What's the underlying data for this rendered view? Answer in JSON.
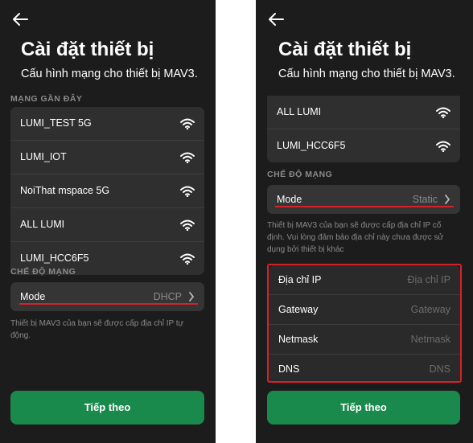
{
  "left_screen": {
    "title": "Cài đặt thiết bị",
    "subtitle": "Cấu hình mạng cho thiết bị MAV3.",
    "recent_networks_header": "MẠNG GẦN ĐÂY",
    "networks": [
      {
        "ssid": "LUMI_TEST 5G"
      },
      {
        "ssid": "LUMI_IOT"
      },
      {
        "ssid": "NoiThat mspace 5G"
      },
      {
        "ssid": "ALL LUMI"
      },
      {
        "ssid": "LUMI_HCC6F5"
      }
    ],
    "network_mode_header": "CHẾ ĐỘ MẠNG",
    "mode_label": "Mode",
    "mode_value": "DHCP",
    "description": "Thiết bị MAV3 của bạn sẽ được cấp địa chỉ IP tự động.",
    "next_button": "Tiếp theo"
  },
  "right_screen": {
    "title": "Cài đặt thiết bị",
    "subtitle": "Cấu hình mạng cho thiết bị MAV3.",
    "networks": [
      {
        "ssid": "ALL LUMI"
      },
      {
        "ssid": "LUMI_HCC6F5"
      }
    ],
    "network_mode_header": "CHẾ ĐỘ MẠNG",
    "mode_label": "Mode",
    "mode_value": "Static",
    "description": "Thiết bị MAV3 của bạn sẽ được cấp địa chỉ IP cố định. Vui lòng đảm bảo địa chỉ này chưa được sử dụng bởi thiết bị khác",
    "static_fields": [
      {
        "label": "Địa chỉ IP",
        "placeholder": "Địa chỉ IP"
      },
      {
        "label": "Gateway",
        "placeholder": "Gateway"
      },
      {
        "label": "Netmask",
        "placeholder": "Netmask"
      },
      {
        "label": "DNS",
        "placeholder": "DNS"
      }
    ],
    "next_button": "Tiếp theo"
  },
  "colors": {
    "background": "#1c1c1c",
    "card": "#2f2f2f",
    "accent_green": "#1a8a4c",
    "highlight_red": "#d4222a"
  }
}
